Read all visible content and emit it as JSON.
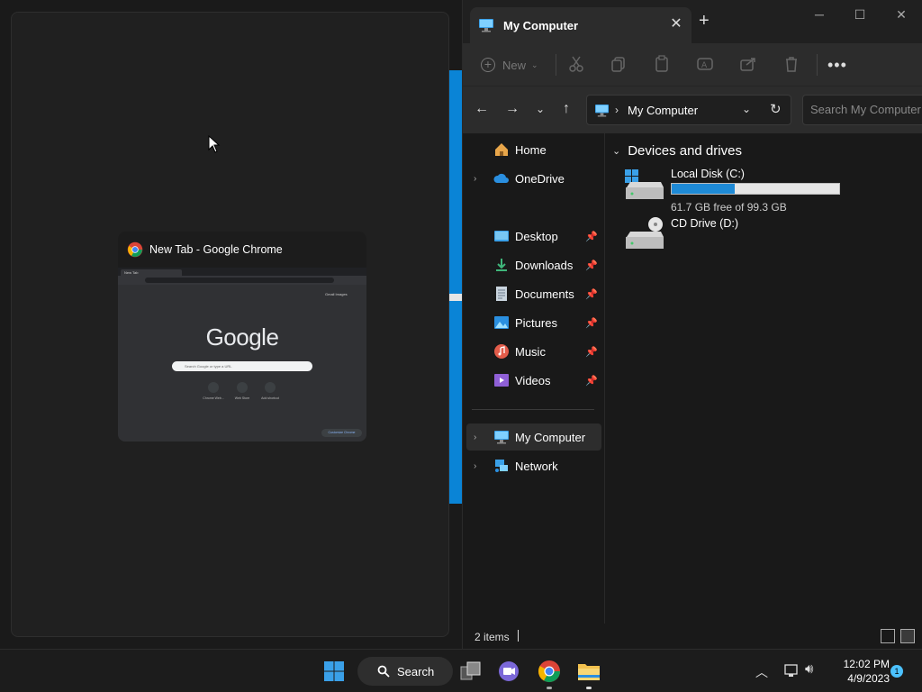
{
  "snap_assist": {
    "thumbnail": {
      "title": "New Tab - Google Chrome",
      "tab_label": "New Tab",
      "google_logo": "Google",
      "search_placeholder": "Search Google or type a URL",
      "shortcuts": [
        "Chrome Web...",
        "Web Store",
        "Add shortcut"
      ],
      "top_links": "Gmail  Images",
      "customize": "Customize Chrome"
    }
  },
  "explorer": {
    "tab_title": "My Computer",
    "toolbar": {
      "new_label": "New"
    },
    "address": {
      "current": "My Computer",
      "search_placeholder": "Search My Computer"
    },
    "nav": {
      "home": "Home",
      "onedrive": "OneDrive",
      "pinned": [
        "Desktop",
        "Downloads",
        "Documents",
        "Pictures",
        "Music",
        "Videos"
      ],
      "my_computer": "My Computer",
      "network": "Network"
    },
    "content": {
      "group_title": "Devices and drives",
      "drives": [
        {
          "name": "Local Disk (C:)",
          "free_text": "61.7 GB free of 99.3 GB",
          "used_fraction": 0.379
        },
        {
          "name": "CD Drive (D:)"
        }
      ]
    },
    "status": {
      "items": "2 items"
    }
  },
  "taskbar": {
    "search_label": "Search",
    "time": "12:02 PM",
    "date": "4/9/2023",
    "notification_count": "1"
  },
  "colors": {
    "accent": "#0a84d6",
    "drive_fill": "#1e8ad6",
    "background": "#1a1a1a"
  }
}
